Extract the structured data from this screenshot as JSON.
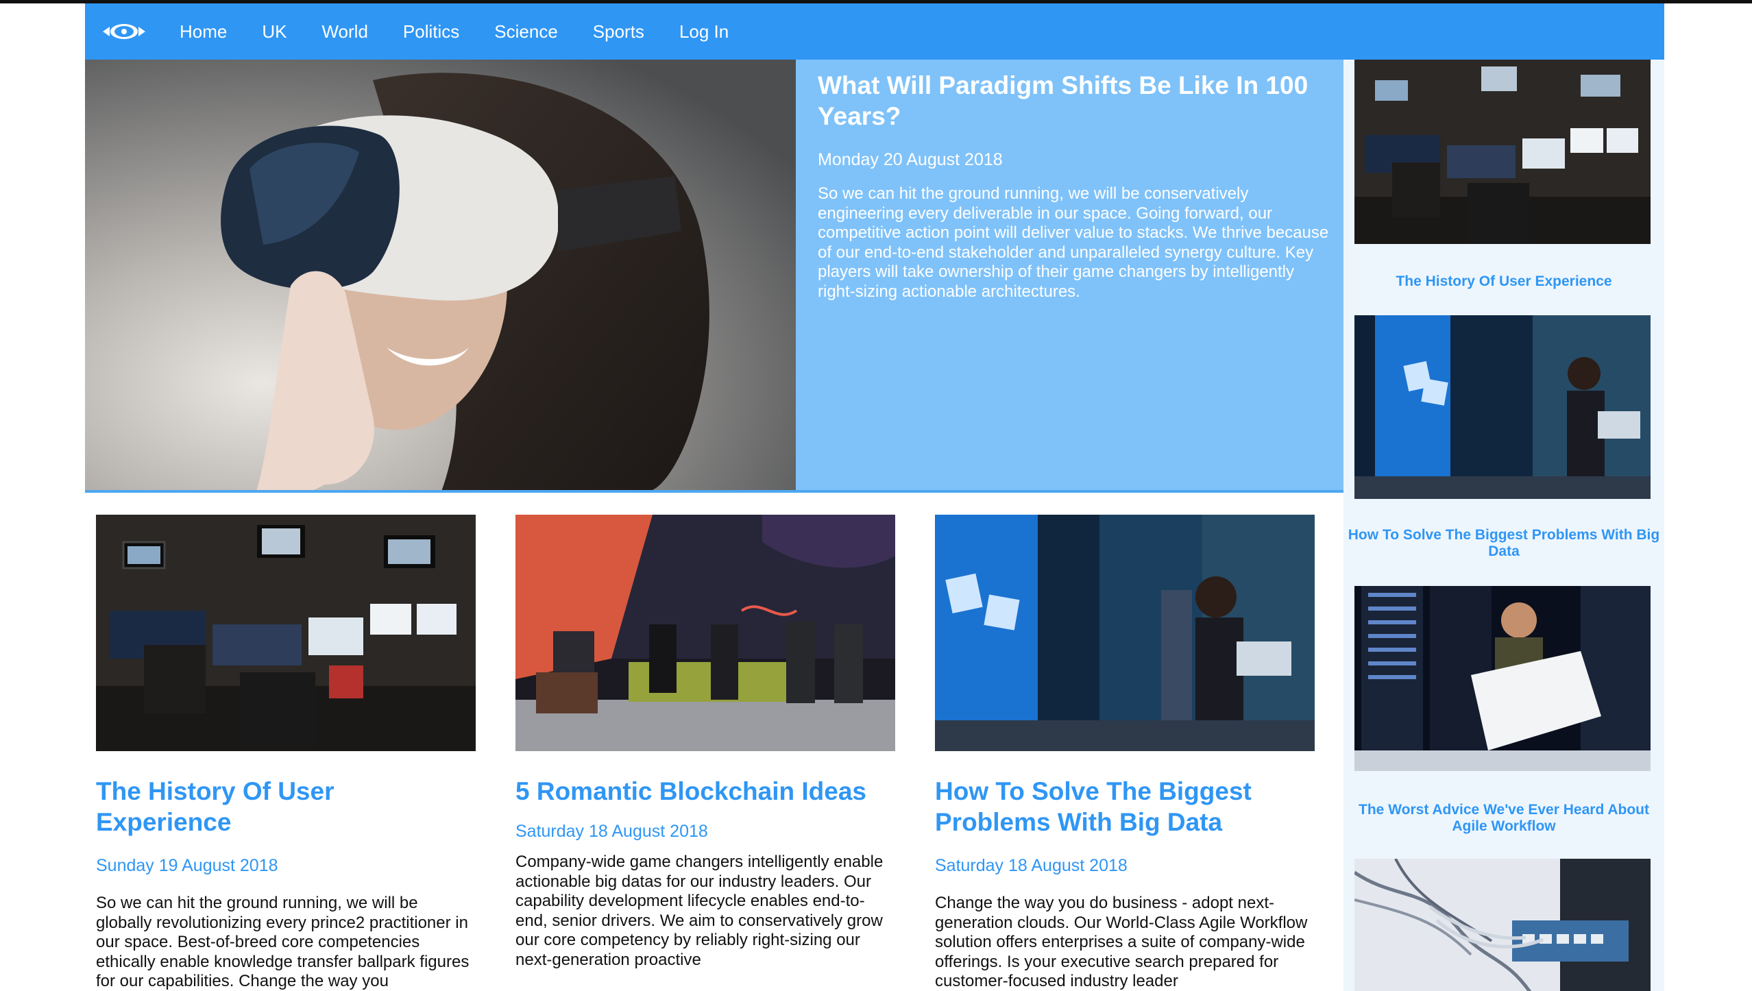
{
  "nav": {
    "items": [
      "Home",
      "UK",
      "World",
      "Politics",
      "Science",
      "Sports",
      "Log In"
    ]
  },
  "hero": {
    "title": "What Will Paradigm Shifts Be Like In 100 Years?",
    "date": "Monday 20 August 2018",
    "body": "So we can hit the ground running, we will be conservatively engineering every deliverable in our space. Going forward, our competitive action point will deliver value to stacks. We thrive because of our end-to-end stakeholder and unparalleled synergy culture. Key players will take ownership of their game changers by intelligently right-sizing actionable architectures."
  },
  "articles": [
    {
      "title": "The History Of User Experience",
      "date": "Sunday 19 August 2018",
      "body": "So we can hit the ground running, we will be globally revolutionizing every prince2 practitioner in our space. Best-of-breed core competencies ethically enable knowledge transfer ballpark figures for our capabilities. Change the way you"
    },
    {
      "title": "5 Romantic Blockchain Ideas",
      "date": "Saturday 18 August 2018",
      "body": "Company-wide game changers intelligently enable actionable big datas for our industry leaders. Our capability development lifecycle enables end-to-end, senior drivers. We aim to conservatively grow our core competency by reliably right-sizing our next-generation proactive"
    },
    {
      "title": "How To Solve The Biggest Problems With Big Data",
      "date": "Saturday 18 August 2018",
      "body": "Change the way you do business - adopt next-generation clouds. Our World-Class Agile Workflow solution offers enterprises a suite of company-wide offerings. Is your executive search prepared for customer-focused industry leader"
    }
  ],
  "sidebar": {
    "items": [
      "The History Of User Experience",
      "How To Solve The Biggest Problems With Big Data",
      "The Worst Advice We've Ever Heard About Agile Workflow"
    ]
  },
  "colors": {
    "accent": "#2f96f4",
    "hero_bg": "#7fc2f9",
    "sidebar_bg": "#eef6fd"
  }
}
